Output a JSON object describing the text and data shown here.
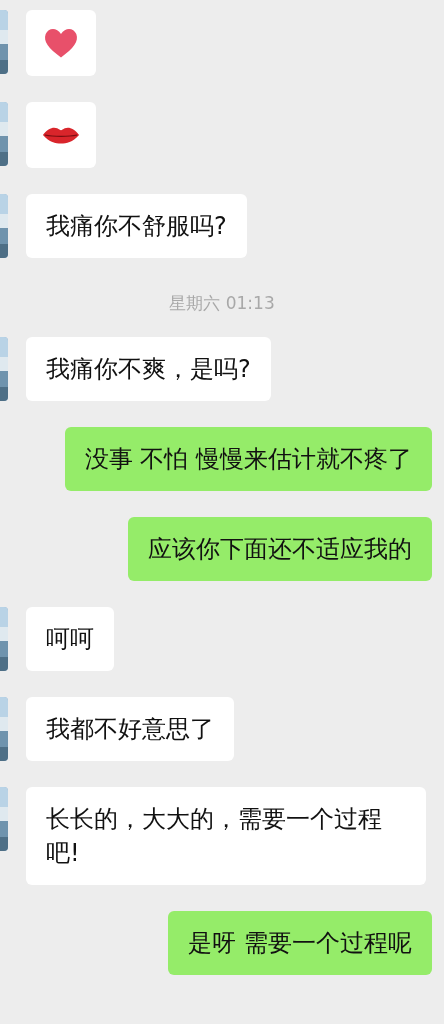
{
  "messages": [
    {
      "kind": "heart-sticker",
      "sent": false
    },
    {
      "kind": "lips-sticker",
      "sent": false
    },
    {
      "kind": "text",
      "sent": false,
      "text": "我痛你不舒服吗?"
    },
    {
      "kind": "time",
      "text": "星期六 01:13"
    },
    {
      "kind": "text",
      "sent": false,
      "text": "我痛你不爽，是吗?"
    },
    {
      "kind": "text",
      "sent": true,
      "text": "没事 不怕 慢慢来估计就不疼了"
    },
    {
      "kind": "text",
      "sent": true,
      "text": "应该你下面还不适应我的"
    },
    {
      "kind": "text",
      "sent": false,
      "text": "呵呵"
    },
    {
      "kind": "text",
      "sent": false,
      "text": "我都不好意思了"
    },
    {
      "kind": "text",
      "sent": false,
      "text": "长长的，大大的，需要一个过程吧!"
    },
    {
      "kind": "text",
      "sent": true,
      "text": "是呀 需要一个过程呢"
    }
  ]
}
